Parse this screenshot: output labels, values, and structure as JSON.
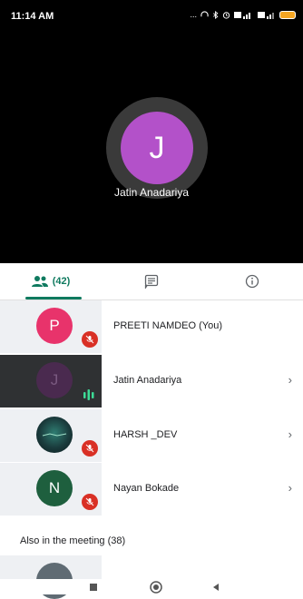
{
  "status": {
    "time": "11:14 AM",
    "indicators": "...",
    "battery_color": "#f5a623"
  },
  "main_video": {
    "avatar_letter": "J",
    "avatar_color": "#b351c9",
    "name": "Jatin Anadariya"
  },
  "tabs": {
    "people_count": "(42)",
    "people_icon": "people-icon",
    "chat_icon": "chat-icon",
    "info_icon": "info-icon",
    "active_color": "#0f7a5f"
  },
  "participants": [
    {
      "letter": "P",
      "color": "#e8336b",
      "name": "PREETI NAMDEO (You)",
      "muted": true,
      "chevron": false
    },
    {
      "letter": "J",
      "color": "#4a2a4f",
      "name": "Jatin Anadariya",
      "muted": false,
      "speaking": true,
      "chevron": true
    },
    {
      "letter": "",
      "color": "#1a3b3c",
      "name": "HARSH _DEV",
      "muted": true,
      "chevron": true
    },
    {
      "letter": "N",
      "color": "#1e5f3e",
      "name": "Nayan Bokade",
      "muted": true,
      "chevron": true
    }
  ],
  "section": {
    "also_label": "Also in the meeting (38)"
  }
}
